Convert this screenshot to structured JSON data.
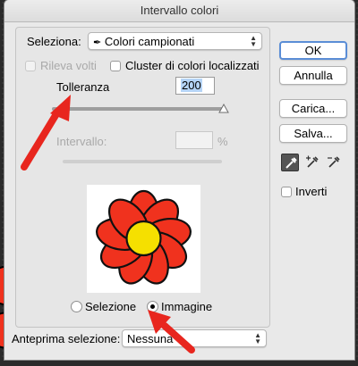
{
  "window": {
    "title": "Intervallo colori"
  },
  "select_row": {
    "label": "Seleziona:",
    "value": "Colori campionati",
    "icon": "eyedropper-icon"
  },
  "options": {
    "detect_faces_label": "Rileva volti",
    "localized_clusters_label": "Cluster di colori localizzati"
  },
  "fuzziness": {
    "label": "Tolleranza",
    "value": "200",
    "slider_fraction": 1.0
  },
  "range": {
    "label": "Intervallo:",
    "value": "",
    "unit": "%"
  },
  "preview_mode": {
    "selection_label": "Selezione",
    "image_label": "Immagine",
    "selected": "Immagine"
  },
  "preview_footer": {
    "label": "Anteprima selezione:",
    "value": "Nessuna"
  },
  "buttons": {
    "ok": "OK",
    "cancel": "Annulla",
    "load": "Carica...",
    "save": "Salva..."
  },
  "eyedroppers": [
    "eyedropper-icon",
    "eyedropper-plus-icon",
    "eyedropper-minus-icon"
  ],
  "invert": {
    "label": "Inverti"
  },
  "colors": {
    "annotation_arrow": "#e8261e",
    "flower_petals": "#f0321e",
    "flower_center": "#f5e000"
  }
}
